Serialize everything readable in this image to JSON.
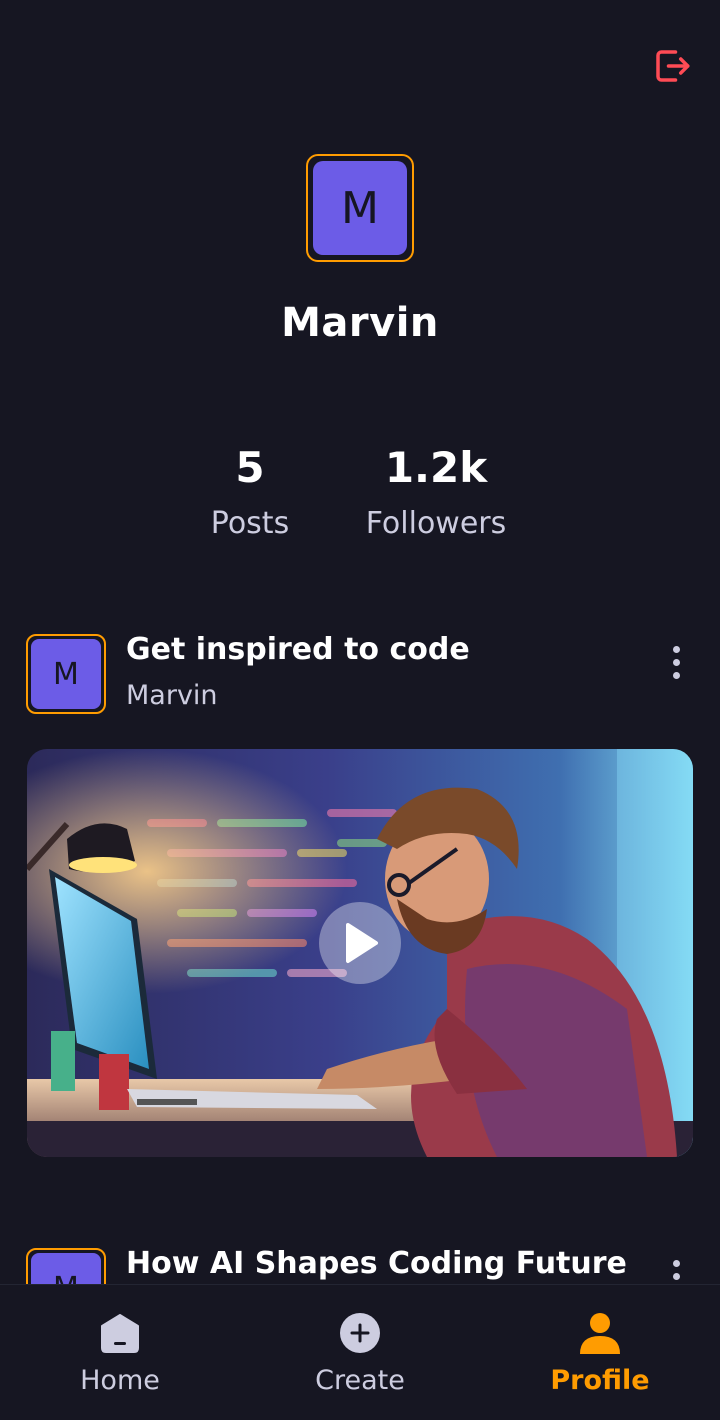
{
  "profile": {
    "avatar_letter": "M",
    "name": "Marvin",
    "stats": {
      "posts_value": "5",
      "posts_label": "Posts",
      "followers_value": "1.2k",
      "followers_label": "Followers"
    }
  },
  "posts": [
    {
      "avatar_letter": "M",
      "title": "Get inspired to code",
      "author": "Marvin"
    },
    {
      "avatar_letter": "M",
      "title": "How AI Shapes Coding Future"
    }
  ],
  "tabs": {
    "home_label": "Home",
    "create_label": "Create",
    "profile_label": "Profile",
    "active": "Profile"
  },
  "icons": {
    "logout": "logout-icon",
    "more": "more-vertical-icon",
    "play": "play-icon",
    "home": "home-icon",
    "create": "plus-circle-icon",
    "profile": "user-icon"
  },
  "colors": {
    "background": "#161622",
    "accent": "#FF9C01",
    "avatar": "#6C5CE7",
    "logout": "#FF4B55",
    "muted_text": "#CDCDE0"
  }
}
